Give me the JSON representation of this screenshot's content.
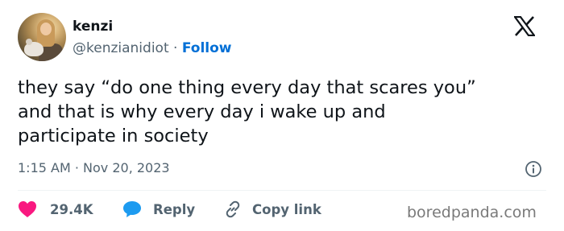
{
  "author": {
    "name": "kenzi",
    "handle": "@kenzianidiot",
    "separator": " · ",
    "follow_label": "Follow"
  },
  "tweet": {
    "lines": [
      "they say “do one thing every day that scares you”",
      "and that is why every day i wake up and",
      "participate in society"
    ],
    "timestamp": "1:15 AM · Nov 20, 2023"
  },
  "actions": {
    "likes": "29.4K",
    "reply_label": "Reply",
    "copy_link_label": "Copy link"
  },
  "icons": {
    "brand": "x-logo-icon",
    "info": "info-icon",
    "like": "heart-icon",
    "reply": "reply-bubble-icon",
    "copy": "link-icon"
  },
  "colors": {
    "like": "#f91880",
    "reply": "#1d9bf0",
    "follow": "#006fd6",
    "muted": "#536471"
  },
  "watermark": "boredpanda.com"
}
